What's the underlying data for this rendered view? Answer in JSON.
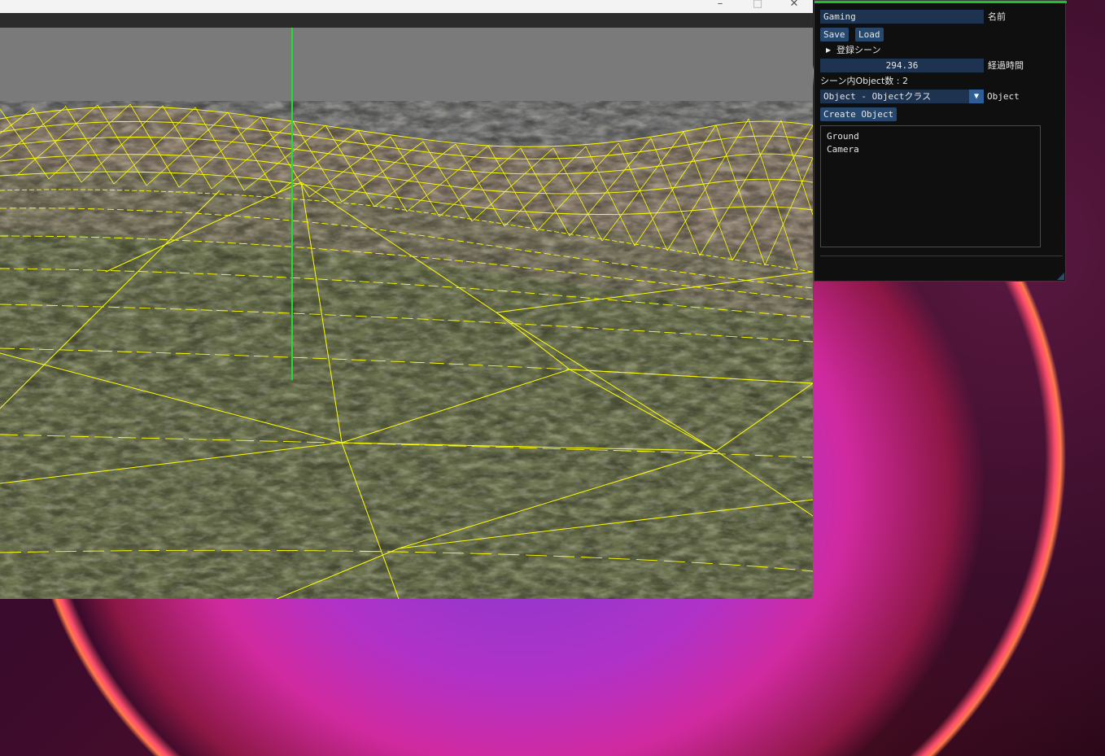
{
  "window": {
    "minimize_glyph": "–",
    "maximize_glyph": "□",
    "close_glyph": "✕"
  },
  "scene_view": {
    "axis_color": "#22dd33",
    "wireframe_color": "#ffff00",
    "sky_color": "#787878",
    "ground_color": "#6e7550"
  },
  "panel": {
    "accent_color": "#1fbf2e",
    "name_field": {
      "value": "Gaming",
      "label": "名前"
    },
    "save_label": "Save",
    "load_label": "Load",
    "registered_scenes": {
      "arrow": "▶",
      "label": "登録シーン"
    },
    "elapsed": {
      "value": "294.36",
      "label": "経過時間"
    },
    "object_count_text": "シーン内Object数 : 2",
    "object_combo": {
      "value": "Object - Objectクラス",
      "arrow": "▼",
      "label": "Object"
    },
    "create_object_label": "Create Object",
    "objects": [
      "Ground",
      "Camera"
    ]
  }
}
